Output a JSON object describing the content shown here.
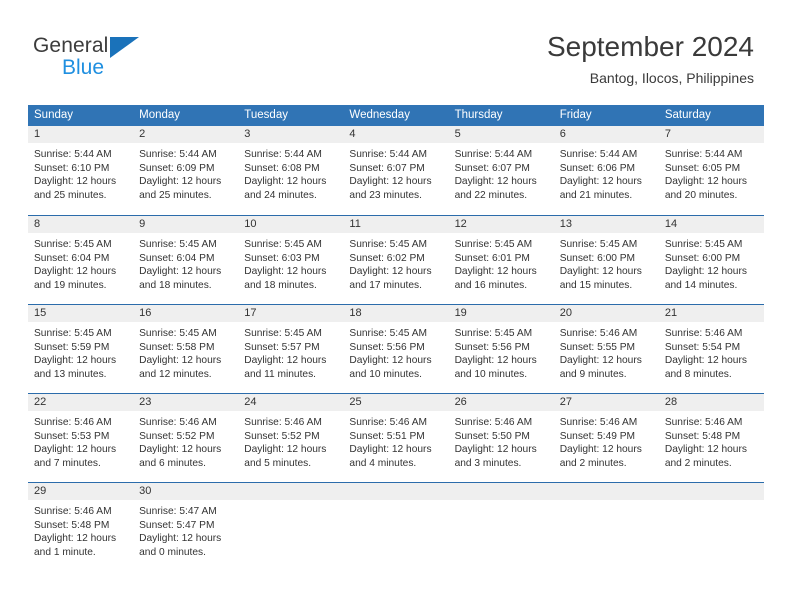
{
  "brand": {
    "line1": "General",
    "line2": "Blue",
    "accent": "#1f8fe0",
    "triangle_color": "#1a72ba"
  },
  "header": {
    "title": "September 2024",
    "location": "Bantog, Ilocos, Philippines"
  },
  "theme": {
    "header_bg": "#3074b5",
    "row_divider": "#2b6cab",
    "daynum_band": "#efefef",
    "text": "#333333"
  },
  "weekdays": [
    "Sunday",
    "Monday",
    "Tuesday",
    "Wednesday",
    "Thursday",
    "Friday",
    "Saturday"
  ],
  "weeks": [
    [
      {
        "day": "1",
        "l1": "Sunrise: 5:44 AM",
        "l2": "Sunset: 6:10 PM",
        "l3": "Daylight: 12 hours",
        "l4": "and 25 minutes."
      },
      {
        "day": "2",
        "l1": "Sunrise: 5:44 AM",
        "l2": "Sunset: 6:09 PM",
        "l3": "Daylight: 12 hours",
        "l4": "and 25 minutes."
      },
      {
        "day": "3",
        "l1": "Sunrise: 5:44 AM",
        "l2": "Sunset: 6:08 PM",
        "l3": "Daylight: 12 hours",
        "l4": "and 24 minutes."
      },
      {
        "day": "4",
        "l1": "Sunrise: 5:44 AM",
        "l2": "Sunset: 6:07 PM",
        "l3": "Daylight: 12 hours",
        "l4": "and 23 minutes."
      },
      {
        "day": "5",
        "l1": "Sunrise: 5:44 AM",
        "l2": "Sunset: 6:07 PM",
        "l3": "Daylight: 12 hours",
        "l4": "and 22 minutes."
      },
      {
        "day": "6",
        "l1": "Sunrise: 5:44 AM",
        "l2": "Sunset: 6:06 PM",
        "l3": "Daylight: 12 hours",
        "l4": "and 21 minutes."
      },
      {
        "day": "7",
        "l1": "Sunrise: 5:44 AM",
        "l2": "Sunset: 6:05 PM",
        "l3": "Daylight: 12 hours",
        "l4": "and 20 minutes."
      }
    ],
    [
      {
        "day": "8",
        "l1": "Sunrise: 5:45 AM",
        "l2": "Sunset: 6:04 PM",
        "l3": "Daylight: 12 hours",
        "l4": "and 19 minutes."
      },
      {
        "day": "9",
        "l1": "Sunrise: 5:45 AM",
        "l2": "Sunset: 6:04 PM",
        "l3": "Daylight: 12 hours",
        "l4": "and 18 minutes."
      },
      {
        "day": "10",
        "l1": "Sunrise: 5:45 AM",
        "l2": "Sunset: 6:03 PM",
        "l3": "Daylight: 12 hours",
        "l4": "and 18 minutes."
      },
      {
        "day": "11",
        "l1": "Sunrise: 5:45 AM",
        "l2": "Sunset: 6:02 PM",
        "l3": "Daylight: 12 hours",
        "l4": "and 17 minutes."
      },
      {
        "day": "12",
        "l1": "Sunrise: 5:45 AM",
        "l2": "Sunset: 6:01 PM",
        "l3": "Daylight: 12 hours",
        "l4": "and 16 minutes."
      },
      {
        "day": "13",
        "l1": "Sunrise: 5:45 AM",
        "l2": "Sunset: 6:00 PM",
        "l3": "Daylight: 12 hours",
        "l4": "and 15 minutes."
      },
      {
        "day": "14",
        "l1": "Sunrise: 5:45 AM",
        "l2": "Sunset: 6:00 PM",
        "l3": "Daylight: 12 hours",
        "l4": "and 14 minutes."
      }
    ],
    [
      {
        "day": "15",
        "l1": "Sunrise: 5:45 AM",
        "l2": "Sunset: 5:59 PM",
        "l3": "Daylight: 12 hours",
        "l4": "and 13 minutes."
      },
      {
        "day": "16",
        "l1": "Sunrise: 5:45 AM",
        "l2": "Sunset: 5:58 PM",
        "l3": "Daylight: 12 hours",
        "l4": "and 12 minutes."
      },
      {
        "day": "17",
        "l1": "Sunrise: 5:45 AM",
        "l2": "Sunset: 5:57 PM",
        "l3": "Daylight: 12 hours",
        "l4": "and 11 minutes."
      },
      {
        "day": "18",
        "l1": "Sunrise: 5:45 AM",
        "l2": "Sunset: 5:56 PM",
        "l3": "Daylight: 12 hours",
        "l4": "and 10 minutes."
      },
      {
        "day": "19",
        "l1": "Sunrise: 5:45 AM",
        "l2": "Sunset: 5:56 PM",
        "l3": "Daylight: 12 hours",
        "l4": "and 10 minutes."
      },
      {
        "day": "20",
        "l1": "Sunrise: 5:46 AM",
        "l2": "Sunset: 5:55 PM",
        "l3": "Daylight: 12 hours",
        "l4": "and 9 minutes."
      },
      {
        "day": "21",
        "l1": "Sunrise: 5:46 AM",
        "l2": "Sunset: 5:54 PM",
        "l3": "Daylight: 12 hours",
        "l4": "and 8 minutes."
      }
    ],
    [
      {
        "day": "22",
        "l1": "Sunrise: 5:46 AM",
        "l2": "Sunset: 5:53 PM",
        "l3": "Daylight: 12 hours",
        "l4": "and 7 minutes."
      },
      {
        "day": "23",
        "l1": "Sunrise: 5:46 AM",
        "l2": "Sunset: 5:52 PM",
        "l3": "Daylight: 12 hours",
        "l4": "and 6 minutes."
      },
      {
        "day": "24",
        "l1": "Sunrise: 5:46 AM",
        "l2": "Sunset: 5:52 PM",
        "l3": "Daylight: 12 hours",
        "l4": "and 5 minutes."
      },
      {
        "day": "25",
        "l1": "Sunrise: 5:46 AM",
        "l2": "Sunset: 5:51 PM",
        "l3": "Daylight: 12 hours",
        "l4": "and 4 minutes."
      },
      {
        "day": "26",
        "l1": "Sunrise: 5:46 AM",
        "l2": "Sunset: 5:50 PM",
        "l3": "Daylight: 12 hours",
        "l4": "and 3 minutes."
      },
      {
        "day": "27",
        "l1": "Sunrise: 5:46 AM",
        "l2": "Sunset: 5:49 PM",
        "l3": "Daylight: 12 hours",
        "l4": "and 2 minutes."
      },
      {
        "day": "28",
        "l1": "Sunrise: 5:46 AM",
        "l2": "Sunset: 5:48 PM",
        "l3": "Daylight: 12 hours",
        "l4": "and 2 minutes."
      }
    ],
    [
      {
        "day": "29",
        "l1": "Sunrise: 5:46 AM",
        "l2": "Sunset: 5:48 PM",
        "l3": "Daylight: 12 hours",
        "l4": "and 1 minute."
      },
      {
        "day": "30",
        "l1": "Sunrise: 5:47 AM",
        "l2": "Sunset: 5:47 PM",
        "l3": "Daylight: 12 hours",
        "l4": "and 0 minutes."
      },
      {
        "day": "",
        "l1": "",
        "l2": "",
        "l3": "",
        "l4": ""
      },
      {
        "day": "",
        "l1": "",
        "l2": "",
        "l3": "",
        "l4": ""
      },
      {
        "day": "",
        "l1": "",
        "l2": "",
        "l3": "",
        "l4": ""
      },
      {
        "day": "",
        "l1": "",
        "l2": "",
        "l3": "",
        "l4": ""
      },
      {
        "day": "",
        "l1": "",
        "l2": "",
        "l3": "",
        "l4": ""
      }
    ]
  ]
}
